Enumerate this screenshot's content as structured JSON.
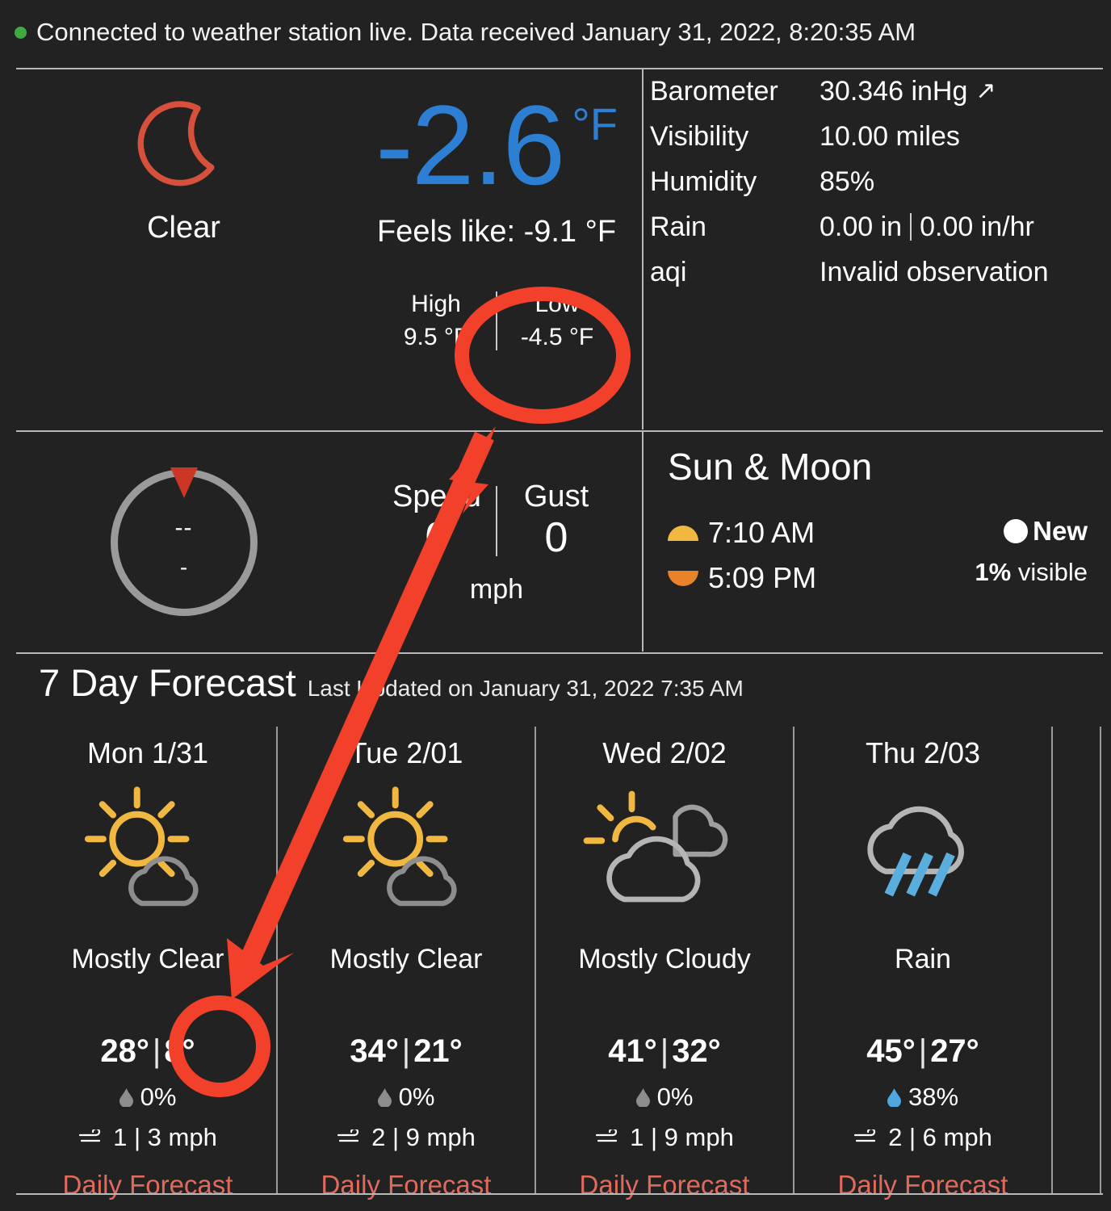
{
  "status": {
    "dot_color": "#3faa3f",
    "text": "Connected to weather station live. Data received January 31, 2022, 8:20:35 AM"
  },
  "current": {
    "condition_icon": "crescent-moon-icon",
    "condition": "Clear",
    "temperature": "-2.6",
    "unit": "°F",
    "feels_like": "Feels like: -9.1 °F",
    "high_label": "High",
    "high_value": "9.5 °F",
    "low_label": "Low",
    "low_value": "-4.5 °F"
  },
  "details": [
    {
      "key": "Barometer",
      "value": "30.346 inHg",
      "trend": "↗"
    },
    {
      "key": "Visibility",
      "value": "10.00 miles",
      "trend": ""
    },
    {
      "key": "Humidity",
      "value": "85%",
      "trend": ""
    },
    {
      "key": "Rain",
      "value": "0.00 in",
      "value2": "0.00 in/hr",
      "trend": ""
    },
    {
      "key": "aqi",
      "value": "Invalid observation",
      "trend": ""
    }
  ],
  "wind": {
    "direction": "--",
    "degrees": "-",
    "speed_label": "Speed",
    "speed_value": "0",
    "gust_label": "Gust",
    "gust_value": "0",
    "unit": "mph"
  },
  "sun_moon": {
    "title": "Sun & Moon",
    "sunrise": "7:10 AM",
    "sunset": "5:09 PM",
    "moon_phase": "New",
    "moon_visible_pct": "1%",
    "moon_visible_label": "visible"
  },
  "forecast": {
    "title": "7 Day Forecast",
    "updated": "Last Updated on January 31, 2022 7:35 AM",
    "link_label": "Daily Forecast",
    "days": [
      {
        "date": "Mon 1/31",
        "icon": "sun-behind-small-cloud-icon",
        "condition": "Mostly Clear",
        "high": "28°",
        "low": "8°",
        "pop": "0%",
        "pop_active": false,
        "wind": "1 | 3 mph"
      },
      {
        "date": "Tue 2/01",
        "icon": "sun-behind-small-cloud-icon",
        "condition": "Mostly Clear",
        "high": "34°",
        "low": "21°",
        "pop": "0%",
        "pop_active": false,
        "wind": "2 | 9 mph"
      },
      {
        "date": "Wed 2/02",
        "icon": "sun-behind-large-cloud-icon",
        "condition": "Mostly Cloudy",
        "high": "41°",
        "low": "32°",
        "pop": "0%",
        "pop_active": false,
        "wind": "1 | 9 mph"
      },
      {
        "date": "Thu 2/03",
        "icon": "rain-cloud-icon",
        "condition": "Rain",
        "high": "45°",
        "low": "27°",
        "pop": "38%",
        "pop_active": true,
        "wind": "2 | 6 mph"
      }
    ]
  },
  "annotations": {
    "color": "#f2402a",
    "ellipse_low_temp": "highlight-low-temperature",
    "circle_forecast_low": "highlight-forecast-low",
    "arrow": "pointer-arrow"
  },
  "colors": {
    "background": "#222222",
    "accent_blue": "#2d7fd3",
    "accent_red": "#d6503c",
    "link_red": "#e06a5c",
    "sun_yellow": "#f0b840",
    "rain_blue": "#5aaede",
    "annotation_red": "#f2402a"
  }
}
